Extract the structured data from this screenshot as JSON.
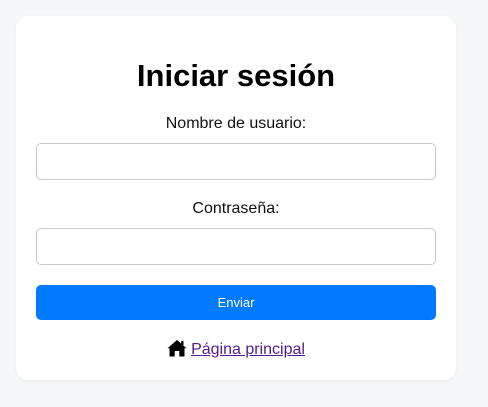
{
  "login": {
    "title": "Iniciar sesión",
    "username_label": "Nombre de usuario:",
    "username_value": "",
    "password_label": "Contraseña:",
    "password_value": "",
    "submit_label": "Enviar",
    "home_link_label": "Página principal",
    "home_icon": "home-icon"
  },
  "colors": {
    "background": "#f6f7f9",
    "card": "#ffffff",
    "accent": "#007bff",
    "link_visited": "#551a8b"
  }
}
